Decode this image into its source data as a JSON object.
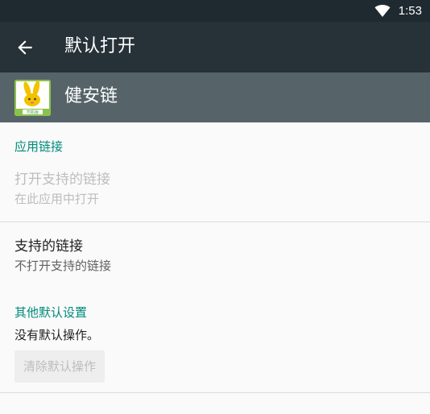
{
  "status_bar": {
    "time": "1:53",
    "wifi_icon": "wifi-icon"
  },
  "toolbar": {
    "back_icon": "arrow-back-icon",
    "title": "默认打开"
  },
  "app_header": {
    "app_name": "健安链",
    "app_icon": "app-rabbit-icon",
    "icon_badge_text": "司机版"
  },
  "app_links": {
    "section_title": "应用链接",
    "open_supported_links": {
      "title": "打开支持的链接",
      "subtitle": "在此应用中打开",
      "enabled": false
    },
    "supported_links": {
      "title": "支持的链接",
      "subtitle": "不打开支持的链接"
    }
  },
  "other_defaults": {
    "section_title": "其他默认设置",
    "message": "没有默认操作。",
    "clear_button": {
      "label": "清除默认操作",
      "enabled": false
    }
  },
  "colors": {
    "status_bar": "#1e2a30",
    "toolbar": "#263238",
    "app_header": "#566469",
    "accent": "#00897b",
    "background": "#fafafa"
  }
}
